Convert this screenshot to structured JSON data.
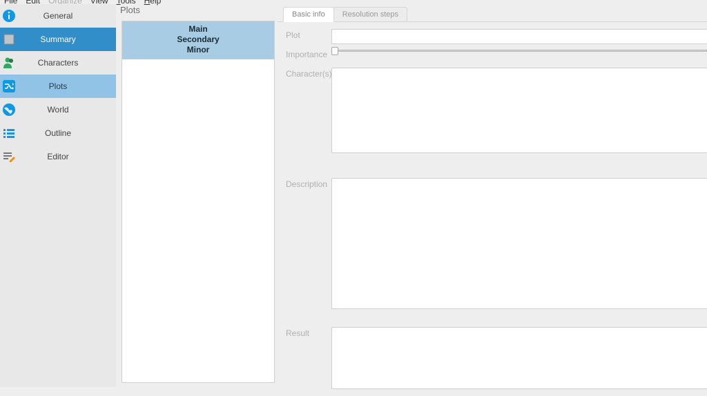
{
  "menubar": {
    "file": "File",
    "edit": "Edit",
    "organize": "Organize",
    "view": "View",
    "tools": "Tools",
    "help": "Help"
  },
  "sidebar": {
    "items": [
      {
        "label": "General",
        "icon": "info"
      },
      {
        "label": "Summary",
        "icon": "doc"
      },
      {
        "label": "Characters",
        "icon": "person"
      },
      {
        "label": "Plots",
        "icon": "shuffle"
      },
      {
        "label": "World",
        "icon": "globe"
      },
      {
        "label": "Outline",
        "icon": "list"
      },
      {
        "label": "Editor",
        "icon": "edit"
      }
    ]
  },
  "midpanel": {
    "title": "Plots",
    "categories": [
      "Main",
      "Secondary",
      "Minor"
    ]
  },
  "tabs": [
    "Basic info",
    "Resolution steps"
  ],
  "form": {
    "plot_label": "Plot",
    "plot_value": "",
    "importance_label": "Importance",
    "importance_value": 0,
    "characters_label": "Character(s)",
    "characters_value": "",
    "description_label": "Description",
    "description_value": "",
    "result_label": "Result",
    "result_value": ""
  }
}
